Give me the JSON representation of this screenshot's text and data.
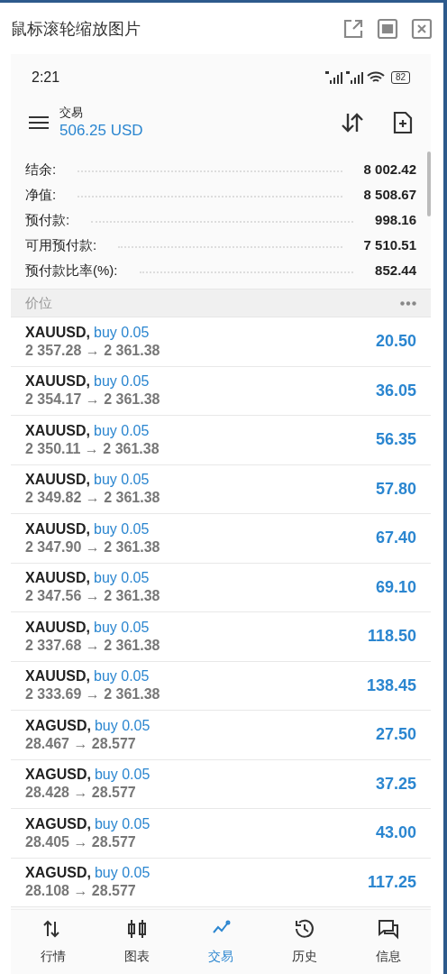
{
  "window": {
    "title": "鼠标滚轮缩放图片"
  },
  "status_bar": {
    "time": "2:21",
    "battery": "82"
  },
  "header": {
    "title": "交易",
    "balance": "506.25 USD"
  },
  "summary": [
    {
      "label": "结余:",
      "value": "8 002.42"
    },
    {
      "label": "净值:",
      "value": "8 508.67"
    },
    {
      "label": "预付款:",
      "value": "998.16"
    },
    {
      "label": "可用预付款:",
      "value": "7 510.51"
    },
    {
      "label": "预付款比率(%):",
      "value": "852.44"
    }
  ],
  "section": {
    "title": "价位"
  },
  "positions": [
    {
      "symbol": "XAUUSD,",
      "order": "buy 0.05",
      "prices": "2 357.28 → 2 361.38",
      "profit": "20.50"
    },
    {
      "symbol": "XAUUSD,",
      "order": "buy 0.05",
      "prices": "2 354.17 → 2 361.38",
      "profit": "36.05"
    },
    {
      "symbol": "XAUUSD,",
      "order": "buy 0.05",
      "prices": "2 350.11 → 2 361.38",
      "profit": "56.35"
    },
    {
      "symbol": "XAUUSD,",
      "order": "buy 0.05",
      "prices": "2 349.82 → 2 361.38",
      "profit": "57.80"
    },
    {
      "symbol": "XAUUSD,",
      "order": "buy 0.05",
      "prices": "2 347.90 → 2 361.38",
      "profit": "67.40"
    },
    {
      "symbol": "XAUUSD,",
      "order": "buy 0.05",
      "prices": "2 347.56 → 2 361.38",
      "profit": "69.10"
    },
    {
      "symbol": "XAUUSD,",
      "order": "buy 0.05",
      "prices": "2 337.68 → 2 361.38",
      "profit": "118.50"
    },
    {
      "symbol": "XAUUSD,",
      "order": "buy 0.05",
      "prices": "2 333.69 → 2 361.38",
      "profit": "138.45"
    },
    {
      "symbol": "XAGUSD,",
      "order": "buy 0.05",
      "prices": "28.467 → 28.577",
      "profit": "27.50"
    },
    {
      "symbol": "XAGUSD,",
      "order": "buy 0.05",
      "prices": "28.428 → 28.577",
      "profit": "37.25"
    },
    {
      "symbol": "XAGUSD,",
      "order": "buy 0.05",
      "prices": "28.405 → 28.577",
      "profit": "43.00"
    },
    {
      "symbol": "XAGUSD,",
      "order": "buy 0.05",
      "prices": "28.108 → 28.577",
      "profit": "117.25"
    }
  ],
  "nav": [
    {
      "kind": "quotes",
      "label": "行情",
      "selected": false
    },
    {
      "kind": "chart",
      "label": "图表",
      "selected": false
    },
    {
      "kind": "trade",
      "label": "交易",
      "selected": true
    },
    {
      "kind": "history",
      "label": "历史",
      "selected": false
    },
    {
      "kind": "messages",
      "label": "信息",
      "selected": false
    }
  ]
}
